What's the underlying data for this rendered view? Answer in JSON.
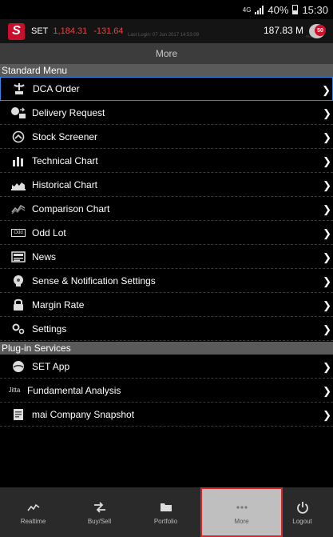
{
  "status_bar": {
    "network": "4G",
    "battery": "40%",
    "time": "15:30"
  },
  "ticker": {
    "logo_letter": "S",
    "index_name": "SET",
    "index_value": "1,184.31",
    "index_change": "-131.64",
    "last_login": "Last Login: 07 Jun 2017 14:53:09",
    "portfolio_value": "187.83 M",
    "sub_label": "realtime",
    "notification_count": "50"
  },
  "header": {
    "title": "More"
  },
  "sections": {
    "standard": {
      "title": "Standard Menu"
    },
    "plugin": {
      "title": "Plug-in Services"
    }
  },
  "standard_items": [
    {
      "label": "DCA Order",
      "icon": "dca-icon"
    },
    {
      "label": "Delivery Request",
      "icon": "delivery-icon"
    },
    {
      "label": "Stock Screener",
      "icon": "screener-icon"
    },
    {
      "label": "Technical Chart",
      "icon": "bar-chart-icon"
    },
    {
      "label": "Historical Chart",
      "icon": "area-chart-icon"
    },
    {
      "label": "Comparison Chart",
      "icon": "comparison-icon"
    },
    {
      "label": "Odd Lot",
      "icon": "odd-lot-icon"
    },
    {
      "label": "News",
      "icon": "news-icon"
    },
    {
      "label": "Sense & Notification Settings",
      "icon": "notification-icon"
    },
    {
      "label": "Margin Rate",
      "icon": "margin-icon"
    },
    {
      "label": "Settings",
      "icon": "gear-icon"
    }
  ],
  "plugin_items": [
    {
      "label": "SET App",
      "icon": "set-app-icon"
    },
    {
      "label": "Fundamental Analysis",
      "icon": "jitta-icon",
      "icon_text": "Jitta"
    },
    {
      "label": "mai Company Snapshot",
      "icon": "document-icon"
    }
  ],
  "odd_lot_icon_text": "Odd",
  "tabs": [
    {
      "label": "Realtime",
      "icon": "realtime-icon"
    },
    {
      "label": "Buy/Sell",
      "icon": "buy-sell-icon"
    },
    {
      "label": "Portfolio",
      "icon": "folder-icon"
    },
    {
      "label": "More",
      "icon": "more-icon"
    },
    {
      "label": "Logout",
      "icon": "power-icon"
    }
  ],
  "colors": {
    "accent_red": "#d9262a",
    "selection_blue": "#2f86e6",
    "negative": "#ff3b3b"
  }
}
